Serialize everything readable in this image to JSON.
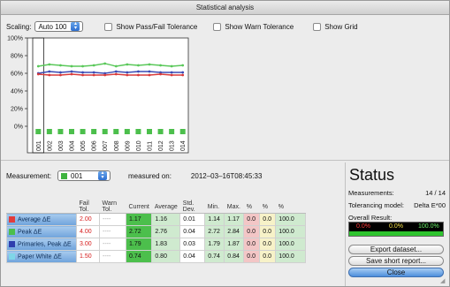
{
  "window": {
    "title": "Statistical analysis"
  },
  "toolbar": {
    "scaling_label": "Scaling:",
    "scaling_value": "Auto 100",
    "show_pass_fail": "Show Pass/Fail Tolerance",
    "show_warn": "Show Warn Tolerance",
    "show_grid": "Show Grid"
  },
  "chart_data": {
    "type": "line",
    "yticks": [
      "100%",
      "80%",
      "60%",
      "40%",
      "20%",
      "0%"
    ],
    "ylim": [
      0,
      100
    ],
    "categories": [
      "001",
      "002",
      "003",
      "004",
      "005",
      "006",
      "007",
      "008",
      "009",
      "010",
      "011",
      "012",
      "013",
      "014"
    ],
    "series": [
      {
        "color": "#5ac85a",
        "values": [
          68,
          70,
          69,
          68,
          68,
          69,
          71,
          68,
          70,
          69,
          70,
          69,
          68,
          69
        ]
      },
      {
        "color": "#3a4bb5",
        "values": [
          60,
          62,
          61,
          62,
          61,
          61,
          60,
          62,
          61,
          62,
          62,
          61,
          61,
          61
        ]
      },
      {
        "color": "#d83b3b",
        "values": [
          59,
          58,
          58,
          59,
          58,
          58,
          58,
          59,
          58,
          58,
          58,
          59,
          58,
          58
        ]
      }
    ],
    "selected": "001"
  },
  "measurement": {
    "label": "Measurement:",
    "value": "001",
    "measured_on_label": "measured on:",
    "measured_on_value": "2012–03–16T08:45:33"
  },
  "table": {
    "headers": [
      "",
      "Fail Tol.",
      "Warn Tol.",
      "Current",
      "Average",
      "Std. Dev.",
      "Min.",
      "Max.",
      "%",
      "%",
      "%"
    ],
    "rows": [
      {
        "name": "Average ΔE",
        "swatch": "#e23b3b",
        "fail": "2.00",
        "warn": "----",
        "current": "1.17",
        "average": "1.16",
        "std": "0.01",
        "min": "1.14",
        "max": "1.17",
        "p1": "0.0",
        "p2": "0.0",
        "p3": "100.0"
      },
      {
        "name": "Peak ΔE",
        "swatch": "#4cbf4c",
        "fail": "4.00",
        "warn": "----",
        "current": "2.72",
        "average": "2.76",
        "std": "0.04",
        "min": "2.72",
        "max": "2.84",
        "p1": "0.0",
        "p2": "0.0",
        "p3": "100.0"
      },
      {
        "name": "Primaries, Peak ΔE",
        "swatch": "#2f3fae",
        "fail": "3.00",
        "warn": "----",
        "current": "1.79",
        "average": "1.83",
        "std": "0.03",
        "min": "1.79",
        "max": "1.87",
        "p1": "0.0",
        "p2": "0.0",
        "p3": "100.0"
      },
      {
        "name": "Paper White ΔE",
        "swatch": "#7fd6e8",
        "fail": "1.50",
        "warn": "----",
        "current": "0.74",
        "average": "0.80",
        "std": "0.04",
        "min": "0.74",
        "max": "0.84",
        "p1": "0.0",
        "p2": "0.0",
        "p3": "100.0"
      }
    ]
  },
  "status": {
    "title": "Status",
    "measurements_label": "Measurements:",
    "measurements_value": "14 / 14",
    "tolerancing_label": "Tolerancing model:",
    "tolerancing_value": "Delta E*00",
    "overall_label": "Overall Result:",
    "result_fail": "0.0%",
    "result_warn": "0.0%",
    "result_pass": "100.0%",
    "export_label": "Export dataset...",
    "save_label": "Save short report...",
    "close_label": "Close"
  }
}
